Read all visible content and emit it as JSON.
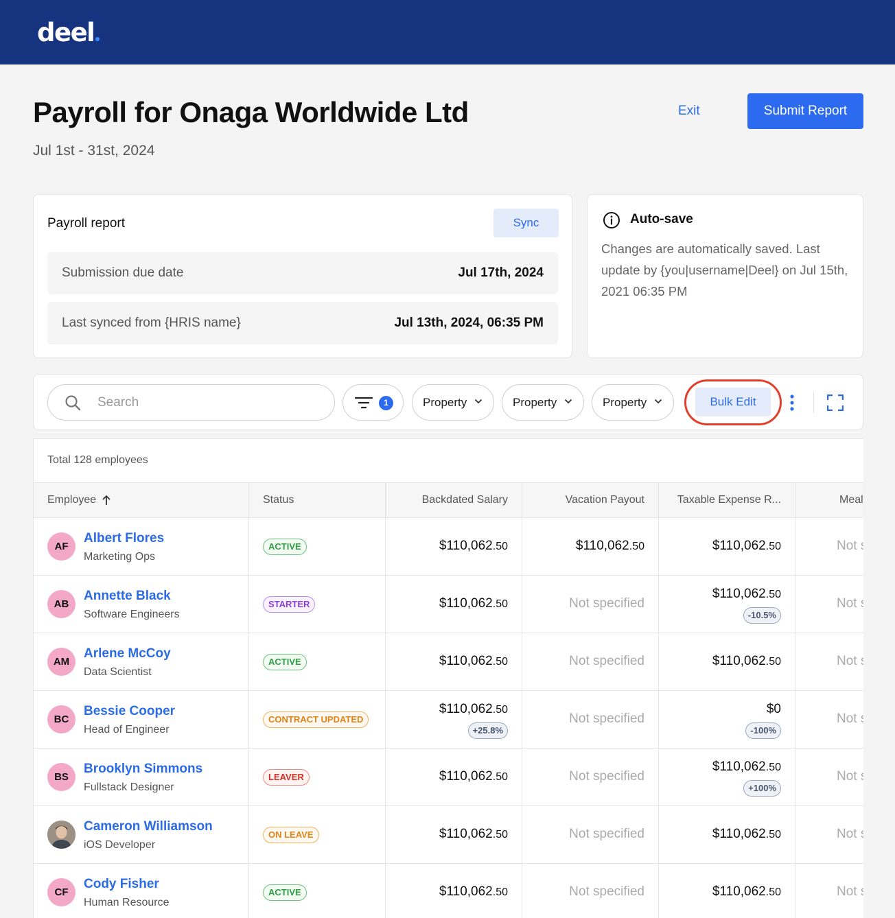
{
  "brand": {
    "logo_text": "deel",
    "accent_color": "#16337f",
    "primary_color": "#2c6bf0"
  },
  "header": {
    "title": "Payroll for Onaga Worldwide Ltd",
    "subtitle": "Jul 1st - 31st, 2024",
    "exit_label": "Exit",
    "submit_label": "Submit Report"
  },
  "report": {
    "title": "Payroll report",
    "sync_label": "Sync",
    "due_label": "Submission due date",
    "due_value": "Jul 17th, 2024",
    "synced_label": "Last synced from {HRIS name}",
    "synced_value": "Jul 13th, 2024, 06:35 PM"
  },
  "autosave": {
    "icon": "info-icon",
    "title": "Auto-save",
    "text": "Changes are automatically saved. Last update by {you|username|Deel} on Jul 15th, 2021 06:35 PM"
  },
  "toolbar": {
    "search_placeholder": "Search",
    "filter_count": "1",
    "property_labels": [
      "Property",
      "Property",
      "Property"
    ],
    "bulk_edit_label": "Bulk Edit"
  },
  "table": {
    "total_label": "Total 128 employees",
    "columns": [
      "Employee",
      "Status",
      "Backdated Salary",
      "Vacation Payout",
      "Taxable Expense R...",
      "Meal"
    ],
    "rows": [
      {
        "initials": "AF",
        "name": "Albert Flores",
        "role": "Marketing Ops",
        "status": "ACTIVE",
        "backdated_main": "$110,062",
        "backdated_cents": ".50",
        "backdated_change": "",
        "vacation_main": "$110,062",
        "vacation_cents": ".50",
        "vacation_text": "",
        "taxable_main": "$110,062",
        "taxable_cents": ".50",
        "taxable_change": "",
        "meal": "Not specified"
      },
      {
        "initials": "AB",
        "name": "Annette Black",
        "role": "Software Engineers",
        "status": "STARTER",
        "backdated_main": "$110,062",
        "backdated_cents": ".50",
        "backdated_change": "",
        "vacation_main": "",
        "vacation_cents": "",
        "vacation_text": "Not specified",
        "taxable_main": "$110,062",
        "taxable_cents": ".50",
        "taxable_change": "-10.5%",
        "meal": "Not specified"
      },
      {
        "initials": "AM",
        "name": "Arlene McCoy",
        "role": "Data Scientist",
        "status": "ACTIVE",
        "backdated_main": "$110,062",
        "backdated_cents": ".50",
        "backdated_change": "",
        "vacation_main": "",
        "vacation_cents": "",
        "vacation_text": "Not specified",
        "taxable_main": "$110,062",
        "taxable_cents": ".50",
        "taxable_change": "",
        "meal": "Not specified"
      },
      {
        "initials": "BC",
        "name": "Bessie Cooper",
        "role": "Head of Engineer",
        "status": "CONTRACT UPDATED",
        "backdated_main": "$110,062",
        "backdated_cents": ".50",
        "backdated_change": "+25.8%",
        "vacation_main": "",
        "vacation_cents": "",
        "vacation_text": "Not specified",
        "taxable_main": "$0",
        "taxable_cents": "",
        "taxable_change": "-100%",
        "meal": "Not specified"
      },
      {
        "initials": "BS",
        "name": "Brooklyn Simmons",
        "role": "Fullstack Designer",
        "status": "LEAVER",
        "backdated_main": "$110,062",
        "backdated_cents": ".50",
        "backdated_change": "",
        "vacation_main": "",
        "vacation_cents": "",
        "vacation_text": "Not specified",
        "taxable_main": "$110,062",
        "taxable_cents": ".50",
        "taxable_change": "+100%",
        "meal": "Not specified"
      },
      {
        "initials": "",
        "name": "Cameron Williamson",
        "role": "iOS Developer",
        "status": "ON LEAVE",
        "backdated_main": "$110,062",
        "backdated_cents": ".50",
        "backdated_change": "",
        "vacation_main": "",
        "vacation_cents": "",
        "vacation_text": "Not specified",
        "taxable_main": "$110,062",
        "taxable_cents": ".50",
        "taxable_change": "",
        "meal": "Not specified"
      },
      {
        "initials": "CF",
        "name": "Cody Fisher",
        "role": "Human Resource",
        "status": "ACTIVE",
        "backdated_main": "$110,062",
        "backdated_cents": ".50",
        "backdated_change": "",
        "vacation_main": "",
        "vacation_cents": "",
        "vacation_text": "Not specified",
        "taxable_main": "$110,062",
        "taxable_cents": ".50",
        "taxable_change": "",
        "meal": "Not specified"
      }
    ]
  }
}
